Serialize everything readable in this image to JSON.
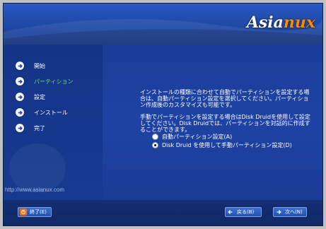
{
  "header": {
    "logo_text_main": "Asia",
    "logo_text_accent": "nux"
  },
  "sidebar": {
    "steps": [
      {
        "label": "開始",
        "active": false
      },
      {
        "label": "パーティション",
        "active": true
      },
      {
        "label": "設定",
        "active": false
      },
      {
        "label": "インストール",
        "active": false
      },
      {
        "label": "完了",
        "active": false
      }
    ],
    "url": "http://www.asianux.com"
  },
  "main": {
    "para1": "インストールの種類に合わせて自動でパーティションを設定する場合は、自動パーティション設定を選択してください。パーティション作成後のカスタマイズも可能です。",
    "para2": "手動でパーティションを設定する場合はDisk Druidを使用して設定してください。Disk Druidでは、パーティションを対話的に作成することができます。",
    "options": [
      {
        "label": "自動パーティション設定(A)",
        "selected": false
      },
      {
        "label": "Disk Druid を使用して手動パーティション設定(D)",
        "selected": true
      }
    ]
  },
  "footer": {
    "exit_label": "終了(E)",
    "back_label": "戻る(B)",
    "next_label": "次へ(N)"
  },
  "colors": {
    "active_step": "#6fe35b",
    "logo_accent": "#ff8a00"
  }
}
